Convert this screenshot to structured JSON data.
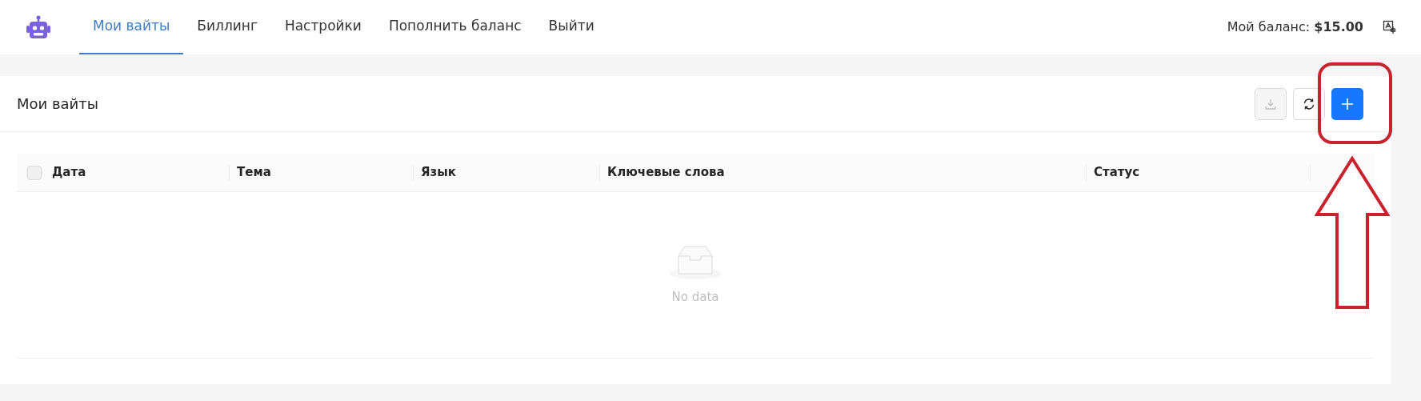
{
  "nav": {
    "tabs": [
      {
        "label": "Мои вайты",
        "selected": true
      },
      {
        "label": "Биллинг",
        "selected": false
      },
      {
        "label": "Настройки",
        "selected": false
      },
      {
        "label": "Пополнить баланс",
        "selected": false
      },
      {
        "label": "Выйти",
        "selected": false
      }
    ],
    "balance_label": "Мой баланс:",
    "balance_value": "$15.00"
  },
  "card": {
    "title": "Мои вайты",
    "buttons": [
      {
        "kind": "download",
        "disabled": true
      },
      {
        "kind": "refresh",
        "disabled": false
      },
      {
        "kind": "add",
        "disabled": false
      }
    ],
    "table": {
      "select_all_checked": false,
      "columns": [
        "Дата",
        "Тема",
        "Язык",
        "Ключевые слова",
        "Статус"
      ],
      "empty_text": "No data"
    }
  }
}
